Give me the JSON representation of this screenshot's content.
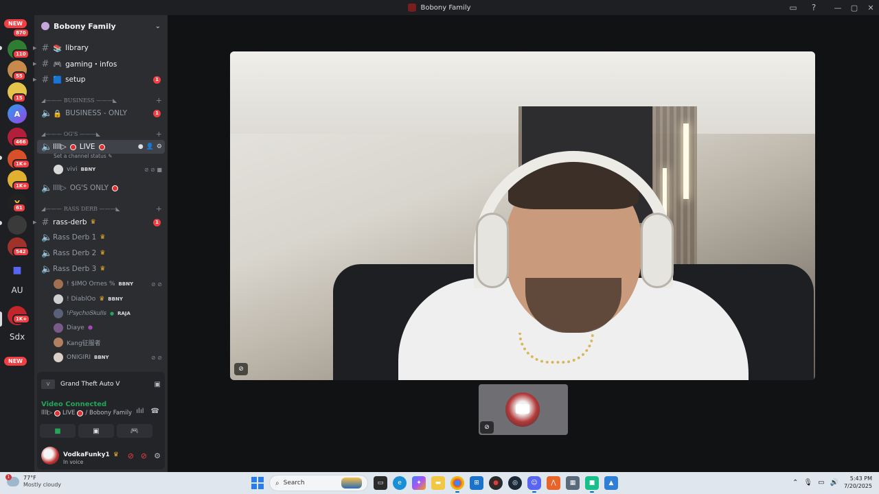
{
  "window": {
    "title": "Bobony Family"
  },
  "rail": {
    "new_top": "NEW",
    "new_bottom": "NEW",
    "badges": [
      "870",
      "110",
      "55",
      "15",
      "466",
      "1K+",
      "1K+",
      "61",
      "542",
      "1K+"
    ],
    "text_servers": [
      "AU",
      "Sdx"
    ],
    "letter_server": "A"
  },
  "sidebar": {
    "server_name": "Bobony Family",
    "channels_top": [
      {
        "name": "library",
        "emoji": "📚",
        "badge": ""
      },
      {
        "name": "gaming・infos",
        "emoji": "🎮",
        "badge": ""
      },
      {
        "name": "setup",
        "emoji": "🟦",
        "badge": "1"
      }
    ],
    "cat_business": "◢——— BUSINESS ———◣",
    "business_only": "BUSINESS - ONLY",
    "business_badge": "1",
    "cat_ogs": "◢——— OG'S ———◣",
    "live_channel": "LIVE",
    "live_prefix": "llll▷",
    "set_status": "Set a channel status",
    "vivi_name": "vivi",
    "vivi_tag": "BBNY",
    "ogs_only": "OG'S ONLY",
    "cat_rass": "◢——— RASS DERB ———◣",
    "rass_derb": "rass-derb",
    "rass_badge": "1",
    "rass_voice": [
      "Rass Derb 1",
      "Rass Derb 2",
      "Rass Derb 3"
    ],
    "members": [
      {
        "name": "! $IMO Ornes %",
        "tag": "BBNY"
      },
      {
        "name": "! DiablOo",
        "tag": "BBNY"
      },
      {
        "name": "!𝑃𝑠𝑦𝑐ℎ𝑜𝑆𝑘𝑢𝑙𝑙𝑠",
        "tag": "RAJA"
      },
      {
        "name": "Diaye",
        "tag": ""
      },
      {
        "name": "Kang征服者",
        "tag": ""
      },
      {
        "name": "ONIGIRI",
        "tag": "BBNY"
      }
    ]
  },
  "activity": {
    "game": "Grand Theft Auto V"
  },
  "voice": {
    "status": "Video Connected",
    "channel": "LIVE",
    "server": "/ Bobony Family"
  },
  "user": {
    "name": "VodkaFunky1",
    "status": "In voice"
  },
  "taskbar": {
    "temp": "77°F",
    "condition": "Mostly cloudy",
    "weather_badge": "1",
    "search_placeholder": "Search",
    "time": "5:43 PM",
    "date": "7/20/2025"
  },
  "colors": {
    "danger": "#f23f43",
    "online": "#23a55a",
    "accent": "#5865f2"
  }
}
